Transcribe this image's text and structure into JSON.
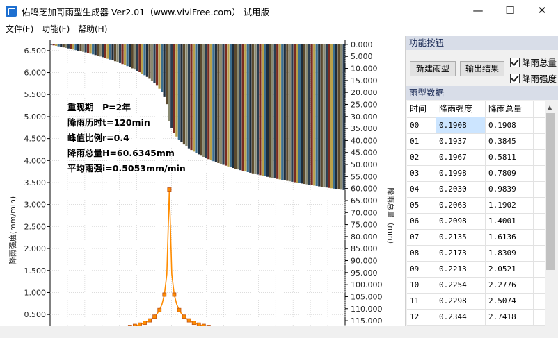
{
  "window": {
    "title": "佑鸣芝加哥雨型生成器 Ver2.01（www.viviFree.com） 试用版",
    "minimize": "—",
    "maximize": "☐",
    "close": "✕"
  },
  "menu": [
    "文件(F)",
    "功能(F)",
    "帮助(H)"
  ],
  "chart_data": {
    "type": "bar+line",
    "annotations": [
      "重现期　P=2年",
      "降雨历时t=120min",
      "峰值比例r=0.4",
      "降雨总量H=60.6345mm",
      "平均雨强i=0.5053mm/min"
    ],
    "ylabel_left": "降雨强度(mm/min)",
    "ylabel_right": "降雨总量（mm）",
    "left_ticks": [
      "6.500",
      "6.000",
      "5.500",
      "5.000",
      "4.500",
      "4.000",
      "3.500",
      "3.000",
      "2.500",
      "2.000",
      "1.500",
      "1.000",
      "0.500"
    ],
    "right_ticks": [
      "0.000",
      "5.000",
      "10.000",
      "15.000",
      "20.000",
      "25.000",
      "30.000",
      "35.000",
      "40.000",
      "45.000",
      "50.000",
      "55.000",
      "60.000",
      "65.000",
      "70.000",
      "75.000",
      "80.000",
      "85.000",
      "90.000",
      "95.000",
      "100.000",
      "105.000",
      "110.000",
      "115.000"
    ],
    "ylim_left": [
      0.25,
      6.75
    ],
    "ylim_right": [
      -2.0,
      117.0
    ],
    "intervals": 120,
    "peak_index": 48,
    "peak_intensity": 3.34,
    "total_rainfall": 60.6345,
    "colors": {
      "curve": "#ff8c00",
      "marker": "#c0561a",
      "bars": [
        "#2c3e50",
        "#7a2c22",
        "#b9a14a",
        "#3b6e8e",
        "#1e2c3b",
        "#5b4a2e",
        "#8a8b73"
      ]
    }
  },
  "panel": {
    "func_header": "功能按钮",
    "btn_new": "新建雨型",
    "btn_export": "输出结果",
    "chk_total": "降雨总量",
    "chk_intensity": "降雨强度",
    "data_header": "雨型数据",
    "columns": [
      "时间",
      "降雨强度",
      "降雨总量"
    ],
    "rows": [
      [
        "00",
        "0.1908",
        "0.1908"
      ],
      [
        "01",
        "0.1937",
        "0.3845"
      ],
      [
        "02",
        "0.1967",
        "0.5811"
      ],
      [
        "03",
        "0.1998",
        "0.7809"
      ],
      [
        "04",
        "0.2030",
        "0.9839"
      ],
      [
        "05",
        "0.2063",
        "1.1902"
      ],
      [
        "06",
        "0.2098",
        "1.4001"
      ],
      [
        "07",
        "0.2135",
        "1.6136"
      ],
      [
        "08",
        "0.2173",
        "1.8309"
      ],
      [
        "09",
        "0.2213",
        "2.0521"
      ],
      [
        "10",
        "0.2254",
        "2.2776"
      ],
      [
        "11",
        "0.2298",
        "2.5074"
      ],
      [
        "12",
        "0.2344",
        "2.7418"
      ]
    ]
  }
}
